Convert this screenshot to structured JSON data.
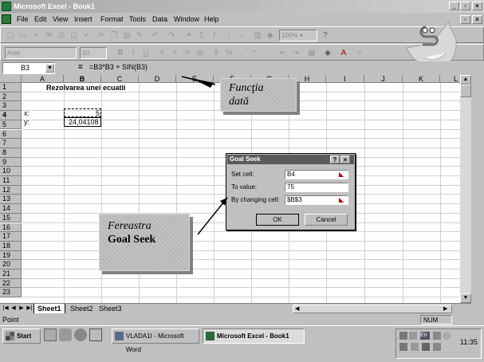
{
  "window": {
    "title": "Microsoft Excel - Book1"
  },
  "menu": {
    "items": [
      "File",
      "Edit",
      "View",
      "Insert",
      "Format",
      "Tools",
      "Data",
      "Window",
      "Help"
    ]
  },
  "toolbar": {
    "zoom": "100%",
    "font_name": "Arial",
    "font_size": "10"
  },
  "formula_bar": {
    "name_box": "B3",
    "equals": "=",
    "formula": "=B3*B3 + SIN(B3)"
  },
  "grid": {
    "columns": [
      "A",
      "B",
      "C",
      "D",
      "E",
      "F",
      "G",
      "H",
      "I",
      "J",
      "K",
      "L"
    ],
    "rows": [
      "1",
      "2",
      "3",
      "4",
      "5",
      "6",
      "7",
      "8",
      "9",
      "10",
      "11",
      "12",
      "13",
      "14",
      "15",
      "16",
      "17",
      "18",
      "19",
      "20",
      "21",
      "22",
      "23"
    ],
    "cells": {
      "title": "Rezolvarea unei ecuatii",
      "a3": "x:",
      "b3": "5",
      "a4": "y:",
      "b4": "24,04108"
    }
  },
  "sheet_tabs": [
    "Sheet1",
    "Sheet2",
    "Sheet3"
  ],
  "status": {
    "left": "Point",
    "num": "NUM"
  },
  "taskbar": {
    "start": "Start",
    "tasks": [
      "VLADA1I - Microsoft Word",
      "Microsoft Excel - Book1"
    ],
    "clock": "11:35"
  },
  "goal_seek": {
    "title": "Goal Seek",
    "set_cell_label": "Set cell:",
    "set_cell": "B4",
    "to_value_label": "To value:",
    "to_value": "75",
    "changing_label": "By changing cell:",
    "changing_cell": "$B$3",
    "ok": "OK",
    "cancel": "Cancel"
  },
  "callouts": {
    "functia_line1": "Funcţia",
    "functia_line2": "dată",
    "fereastra_line1": "Fereastra",
    "fereastra_line2": "Goal Seek"
  }
}
